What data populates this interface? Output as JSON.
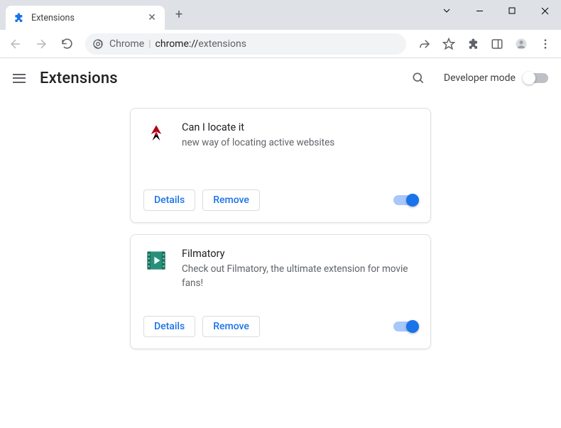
{
  "window": {
    "tab_title": "Extensions"
  },
  "omnibox": {
    "host": "Chrome",
    "path_prefix": "chrome://",
    "path_suffix": "extensions"
  },
  "header": {
    "title": "Extensions",
    "developer_mode_label": "Developer mode",
    "developer_mode_on": false
  },
  "buttons": {
    "details": "Details",
    "remove": "Remove"
  },
  "extensions": [
    {
      "name": "Can I locate it",
      "description": "new way of locating active websites",
      "enabled": true,
      "icon": "phoenix"
    },
    {
      "name": "Filmatory",
      "description": "Check out Filmatory, the ultimate extension for movie fans!",
      "enabled": true,
      "icon": "film"
    }
  ]
}
